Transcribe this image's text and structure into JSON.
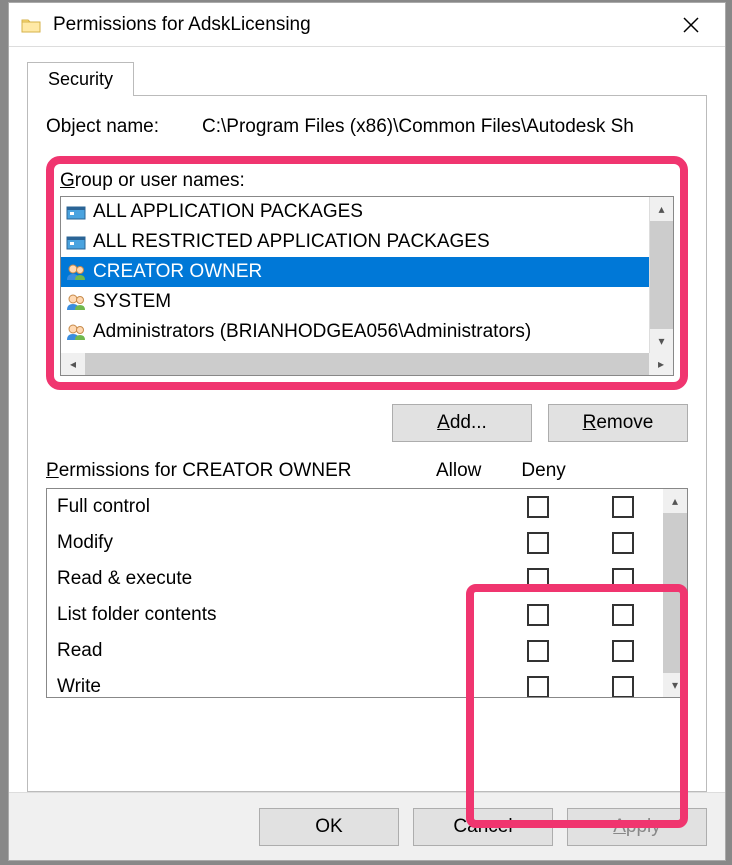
{
  "titlebar": {
    "title": "Permissions for AdskLicensing"
  },
  "tabs": {
    "security": "Security"
  },
  "object": {
    "label": "Object name:",
    "value": "C:\\Program Files (x86)\\Common Files\\Autodesk Sh"
  },
  "group_section": {
    "label_pre": "G",
    "label_post": "roup or user names:"
  },
  "users": [
    {
      "name": "ALL APPLICATION PACKAGES",
      "icon_type": "package",
      "selected": false
    },
    {
      "name": "ALL RESTRICTED APPLICATION PACKAGES",
      "icon_type": "package",
      "selected": false
    },
    {
      "name": "CREATOR OWNER",
      "icon_type": "usergroup",
      "selected": true
    },
    {
      "name": "SYSTEM",
      "icon_type": "usergroup",
      "selected": false
    },
    {
      "name": "Administrators (BRIANHODGEA056\\Administrators)",
      "icon_type": "usergroup",
      "selected": false
    }
  ],
  "buttons": {
    "add_pre": "A",
    "add_post": "dd...",
    "remove_pre": "R",
    "remove_post": "emove",
    "ok": "OK",
    "cancel": "Cancel",
    "apply_pre": "A",
    "apply_post": "pply"
  },
  "perm_section": {
    "title_pre": "P",
    "title_post": "ermissions for CREATOR OWNER",
    "allow": "Allow",
    "deny": "Deny"
  },
  "permissions": [
    {
      "name": "Full control",
      "allow": false,
      "deny": false
    },
    {
      "name": "Modify",
      "allow": false,
      "deny": false
    },
    {
      "name": "Read & execute",
      "allow": false,
      "deny": false
    },
    {
      "name": "List folder contents",
      "allow": false,
      "deny": false
    },
    {
      "name": "Read",
      "allow": false,
      "deny": false
    },
    {
      "name": "Write",
      "allow": false,
      "deny": false
    }
  ],
  "colors": {
    "highlight": "#f0356f",
    "selection": "#0078d7"
  }
}
